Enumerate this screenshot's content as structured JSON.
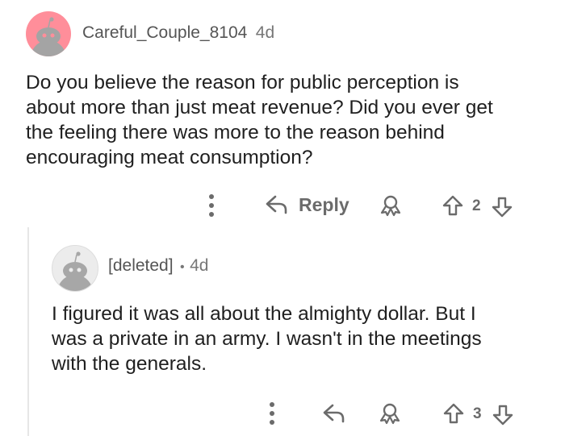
{
  "comment": {
    "username": "Careful_Couple_8104",
    "age": "4d",
    "body": [
      "Do you believe the reason for public perception is",
      "about more than just meat revenue? Did you ever get",
      "the feeling there was more to the reason behind",
      "encouraging meat consumption?"
    ],
    "actions": {
      "reply_label": "Reply",
      "vote_count": "2"
    },
    "avatar_color": "#ff8e9a"
  },
  "reply": {
    "username": "[deleted]",
    "separator": "•",
    "age": "4d",
    "body": [
      "I figured it was all about the almighty dollar. But I",
      "was a private in an army. I wasn't in the meetings",
      "with the generals."
    ],
    "actions": {
      "vote_count": "3"
    },
    "avatar_color": "#e9e9e9"
  },
  "colors": {
    "icon_gray": "#6b6b6b",
    "text": "#1f1f1f",
    "thread_line": "#e6e6e6"
  }
}
